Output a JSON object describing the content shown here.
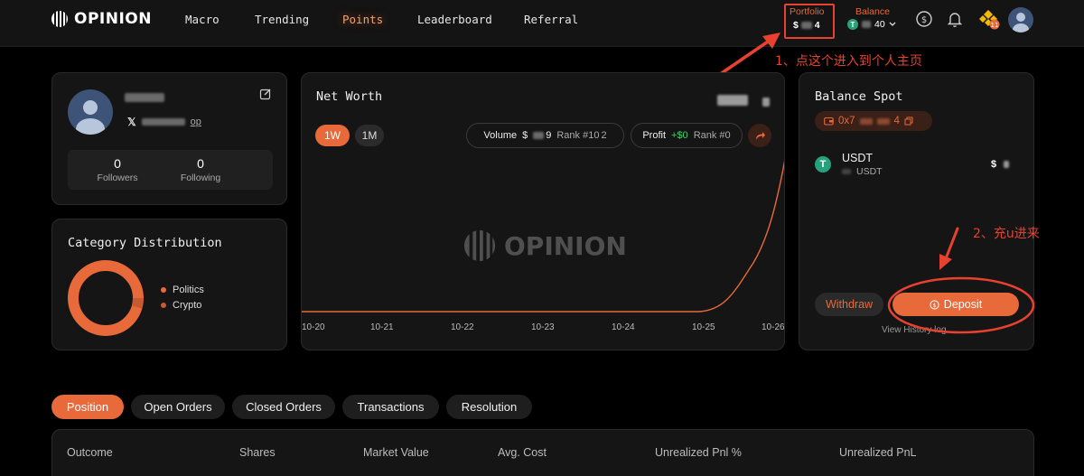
{
  "nav": {
    "brand": "OPINION",
    "links": [
      "Macro",
      "Trending",
      "Points",
      "Leaderboard",
      "Referral"
    ],
    "active_link": "Points",
    "portfolio_label": "Portfolio",
    "portfolio_value_start": "$",
    "portfolio_value_end": "4",
    "balance_label": "Balance",
    "balance_value_end": "40",
    "balance_token_letter": "T",
    "badge_count": "11",
    "icons": [
      "dollar-circle-icon",
      "bell-icon",
      "bnb-chain-icon",
      "avatar-icon",
      "chevron-down-icon"
    ]
  },
  "annotations": {
    "step1": "1、点这个进入到个人主页",
    "step2": "2、充u进来"
  },
  "profile": {
    "handle_suffix": "op",
    "followers_count": "0",
    "followers_label": "Followers",
    "following_count": "0",
    "following_label": "Following"
  },
  "category": {
    "title": "Category Distribution",
    "legend": [
      "Politics",
      "Crypto"
    ],
    "colors": {
      "politics": "#e8693a",
      "crypto": "#c75b30"
    }
  },
  "networth": {
    "title": "Net Worth",
    "range_tabs": [
      "1W",
      "1M"
    ],
    "active_range": "1W",
    "volume_label": "Volume",
    "volume_value_start": "$",
    "volume_value_end": "9",
    "volume_rank": "Rank #10",
    "volume_rank_end": "2",
    "profit_label": "Profit",
    "profit_value": "+$0",
    "profit_rank": "Rank #0",
    "watermark": "OPINION",
    "x_labels": [
      "10-20",
      "10-21",
      "10-22",
      "10-23",
      "10-24",
      "10-25",
      "10-26"
    ]
  },
  "balance_spot": {
    "title": "Balance Spot",
    "address_start": "0x7",
    "address_end": "4",
    "asset_name": "USDT",
    "asset_sub": "USDT",
    "asset_value_start": "$",
    "withdraw_label": "Withdraw",
    "deposit_label": "Deposit",
    "history_label": "View History log"
  },
  "tabs": [
    "Position",
    "Open Orders",
    "Closed Orders",
    "Transactions",
    "Resolution"
  ],
  "active_tab": "Position",
  "table": {
    "headers": [
      "Outcome",
      "Shares",
      "Market Value",
      "Avg. Cost",
      "Unrealized Pnl %",
      "Unrealized PnL"
    ]
  },
  "colors": {
    "accent": "#e8693a",
    "annotation": "#e8412f",
    "profit": "#3ccf6b"
  }
}
